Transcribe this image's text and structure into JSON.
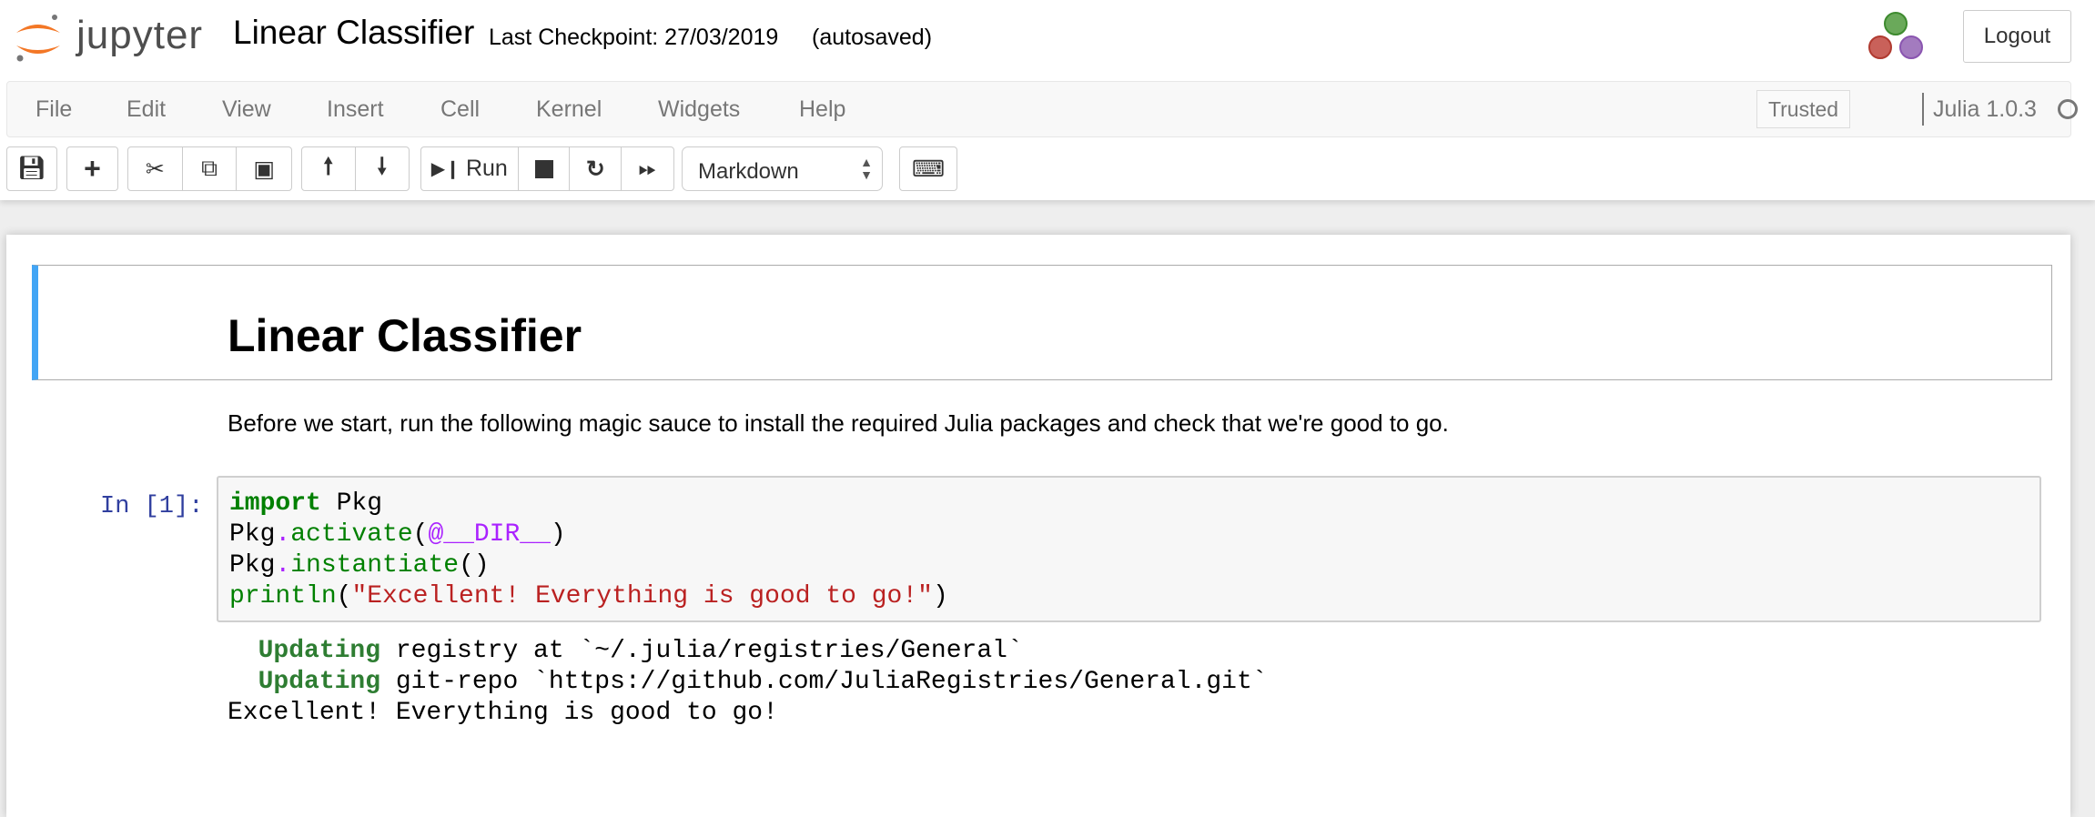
{
  "header": {
    "logo_text": "jupyter",
    "notebook_name": "Linear Classifier",
    "checkpoint": "Last Checkpoint: 27/03/2019",
    "autosave": "(autosaved)",
    "logout_label": "Logout",
    "kernel_logo": "julia-logo"
  },
  "menubar": {
    "items": [
      "File",
      "Edit",
      "View",
      "Insert",
      "Cell",
      "Kernel",
      "Widgets",
      "Help"
    ],
    "trusted": "Trusted",
    "kernel_name": "Julia 1.0.3",
    "kernel_status": "idle"
  },
  "toolbar": {
    "run_label": "Run",
    "cell_type": "Markdown",
    "icons": [
      "save-icon",
      "plus-icon",
      "cut-icon",
      "copy-icon",
      "paste-icon",
      "arrow-up-icon",
      "arrow-down-icon",
      "run-icon",
      "stop-icon",
      "restart-icon",
      "fast-forward-icon",
      "keyboard-icon"
    ]
  },
  "notebook": {
    "heading": "Linear Classifier",
    "paragraph": "Before we start, run the following magic sauce to install the required Julia packages and check that we're good to go.",
    "cell": {
      "prompt": "In [1]:",
      "code": {
        "l1_kw": "import",
        "l1_rest": " Pkg",
        "l2_a": "Pkg",
        "l2_b": ".",
        "l2_c": "activate",
        "l2_d": "(",
        "l2_e": "@__DIR__",
        "l2_f": ")",
        "l3_a": "Pkg",
        "l3_b": ".",
        "l3_c": "instantiate",
        "l3_d": "()",
        "l4_a": "println",
        "l4_b": "(",
        "l4_c": "\"Excellent! Everything is good to go!\"",
        "l4_d": ")"
      },
      "output": {
        "o1_a": "  Updating",
        "o1_b": " registry at `~/.julia/registries/General`",
        "o2_a": "  Updating",
        "o2_b": " git-repo `https://github.com/JuliaRegistries/General.git`",
        "o3": "Excellent! Everything is good to go!"
      }
    }
  },
  "colors": {
    "accent": "#42a5f5",
    "prompt": "#303f9f",
    "keyword": "#008000",
    "string": "#ba2121",
    "operator": "#aa22ff"
  }
}
